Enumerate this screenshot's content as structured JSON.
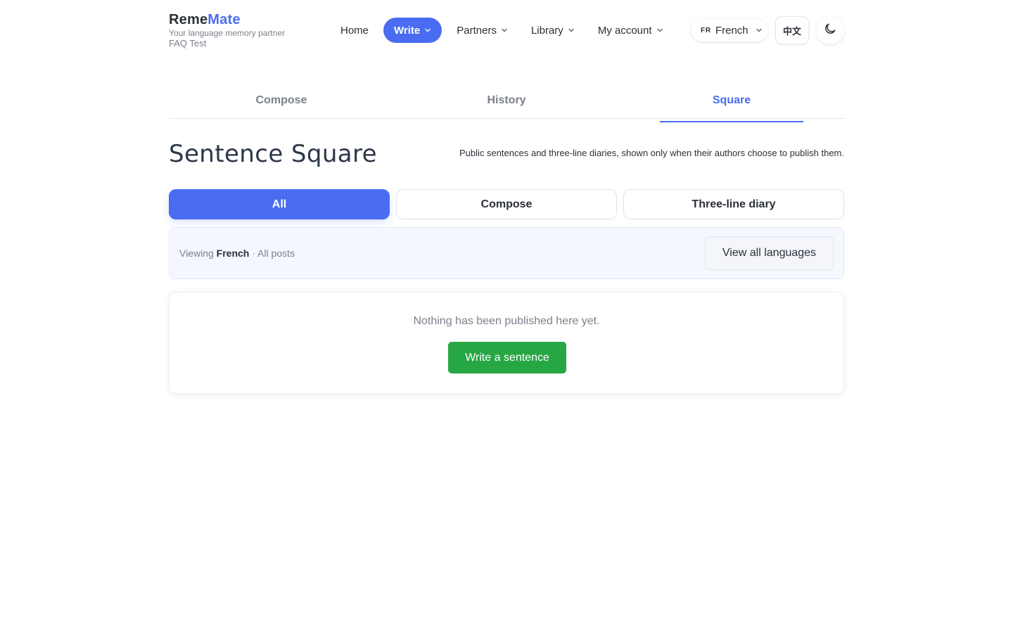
{
  "brand": {
    "logo_part1": "Reme",
    "logo_part2": "Mate",
    "tagline": "Your language memory partner",
    "sub": "FAQ Test"
  },
  "nav": {
    "home": "Home",
    "write": "Write",
    "partners": "Partners",
    "library": "Library",
    "account": "My account"
  },
  "language": {
    "code": "FR",
    "name": "French"
  },
  "ui_lang_button": "中文",
  "theme_icon": "moon-icon",
  "tabs": {
    "compose": "Compose",
    "history": "History",
    "square": "Square"
  },
  "page": {
    "title": "Sentence Square",
    "description": "Public sentences and three-line diaries, shown only when their authors choose to publish them."
  },
  "filters": {
    "all": "All",
    "compose": "Compose",
    "diary": "Three-line diary"
  },
  "viewing": {
    "prefix": "Viewing",
    "language": "French",
    "suffix": "· All posts",
    "view_all": "View all languages"
  },
  "empty": {
    "message": "Nothing has been published here yet.",
    "cta": "Write a sentence"
  },
  "colors": {
    "accent": "#4a6cf0",
    "cta_green": "#27a644"
  }
}
